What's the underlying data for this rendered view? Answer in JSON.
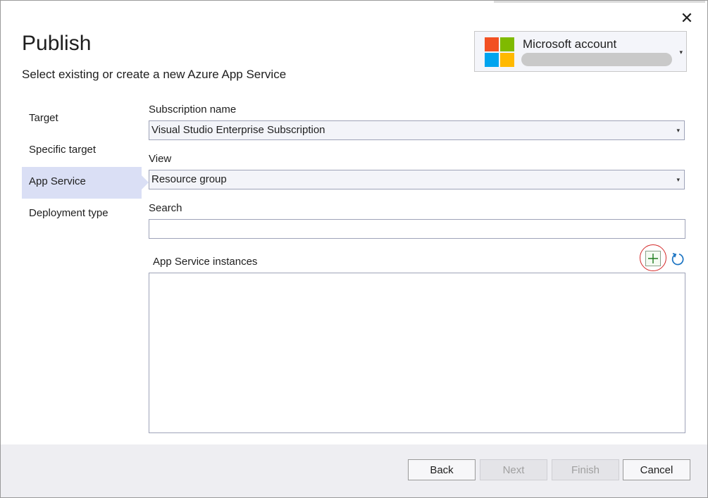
{
  "window": {
    "close_glyph": "✕",
    "title": "Publish",
    "subtitle": "Select existing or create a new Azure App Service"
  },
  "account": {
    "name": "Microsoft account",
    "logo_colors": [
      "#f25022",
      "#7fba00",
      "#00a4ef",
      "#ffb900"
    ],
    "caret": "▾"
  },
  "nav": {
    "items": [
      {
        "label": "Target"
      },
      {
        "label": "Specific target"
      },
      {
        "label": "App Service",
        "active": true
      },
      {
        "label": "Deployment type"
      }
    ]
  },
  "form": {
    "subscription_label": "Subscription name",
    "subscription_value": "Visual Studio Enterprise Subscription",
    "view_label": "View",
    "view_value": "Resource group",
    "search_label": "Search",
    "search_value": "",
    "instances_label": "App Service instances",
    "caret": "▾"
  },
  "icons": {
    "add": "plus-icon",
    "refresh": "refresh-icon",
    "add_color": "#1e7d1e",
    "refresh_color": "#1a73c2",
    "highlight_color": "#d42a2a"
  },
  "footer": {
    "back_label": "Back",
    "next_label": "Next",
    "finish_label": "Finish",
    "cancel_label": "Cancel"
  }
}
